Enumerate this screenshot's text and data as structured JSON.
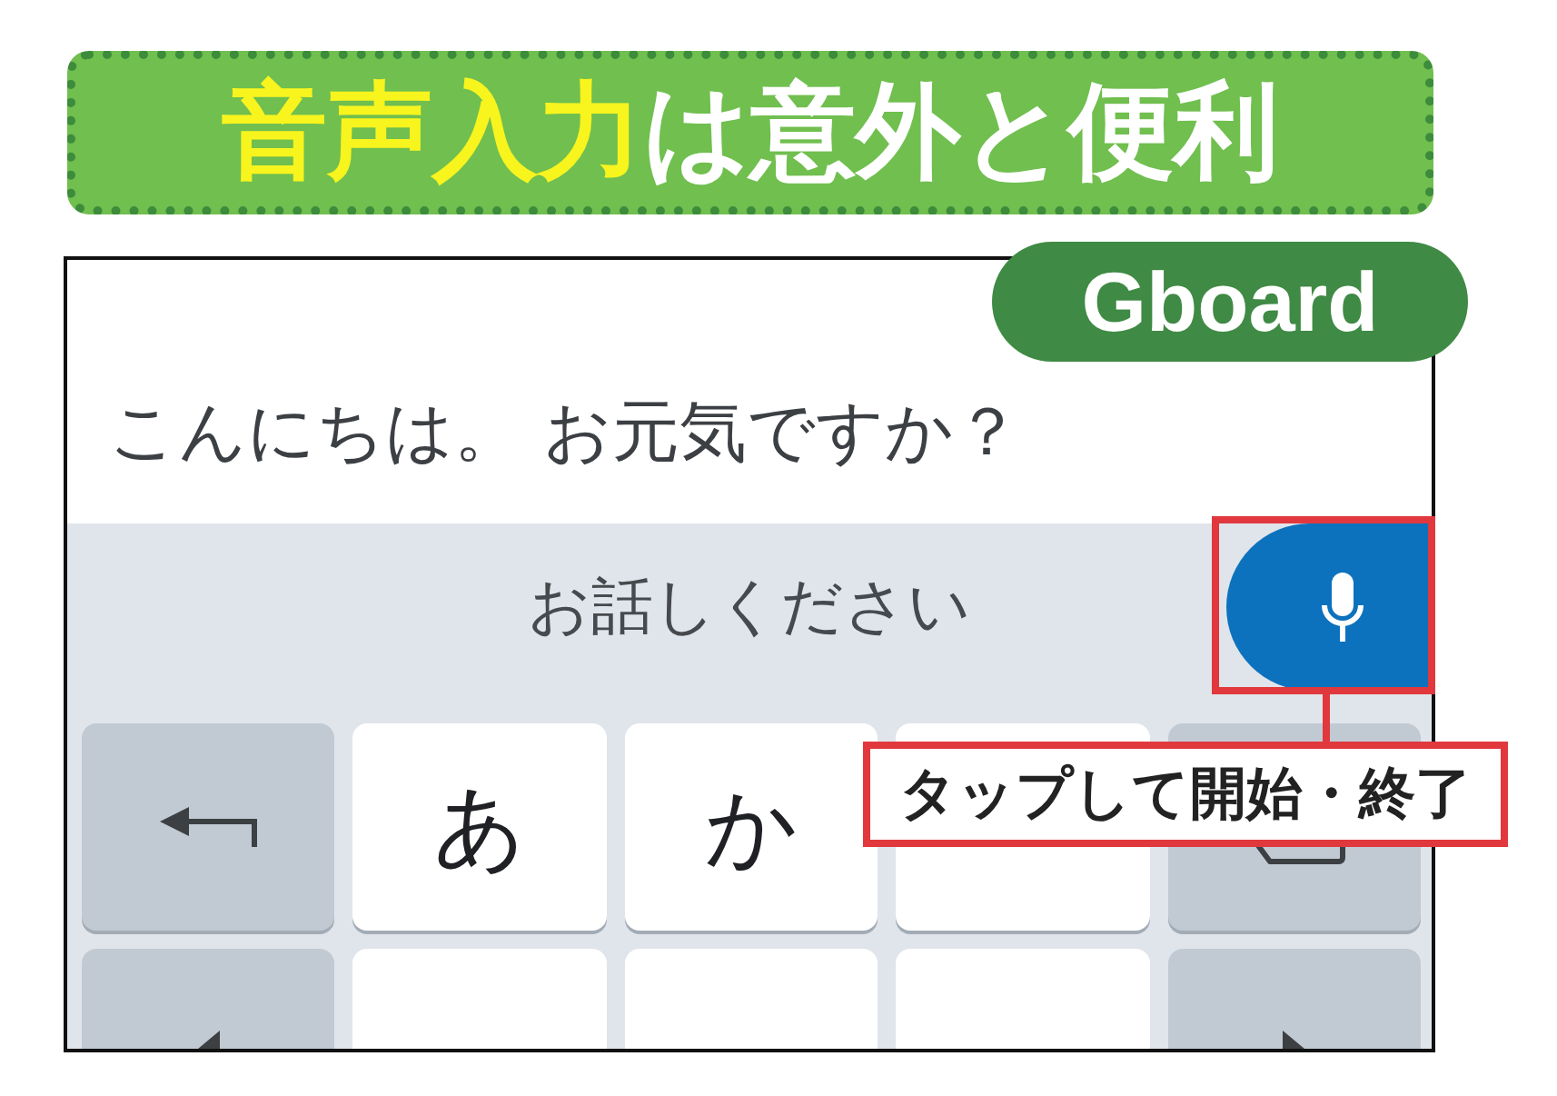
{
  "title": {
    "parts": [
      {
        "text": "音声入力",
        "kind": "highlight"
      },
      {
        "text": "は意外と便利",
        "kind": "plain"
      }
    ]
  },
  "app_badge": {
    "label": "Gboard"
  },
  "text_field": {
    "value": "こんにちは。 お元気ですか？"
  },
  "voice_bar": {
    "prompt": "お話しください"
  },
  "keyboard": {
    "rows": [
      [
        {
          "kind": "back"
        },
        {
          "kind": "char",
          "label": "あ"
        },
        {
          "kind": "char",
          "label": "か"
        },
        {
          "kind": "char"
        },
        {
          "kind": "backspace"
        }
      ],
      [
        {
          "kind": "left"
        },
        {
          "kind": "char"
        },
        {
          "kind": "char"
        },
        {
          "kind": "char"
        },
        {
          "kind": "right"
        }
      ]
    ]
  },
  "callout": {
    "text": "タップして開始・終了"
  }
}
